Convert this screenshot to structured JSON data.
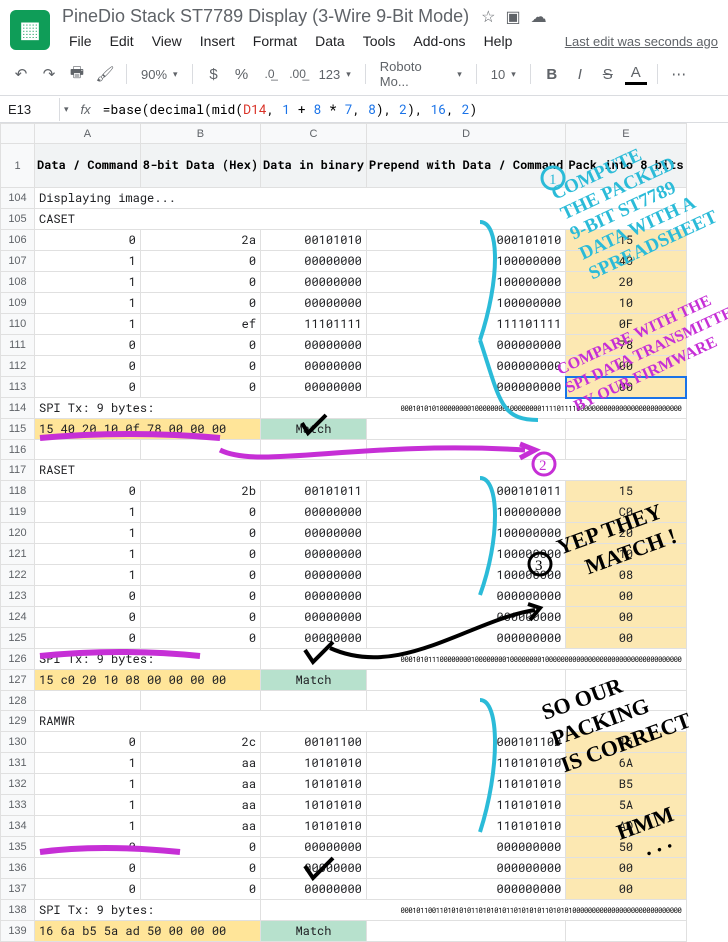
{
  "doc_title": "PineDio Stack ST7789 Display (3-Wire 9-Bit Mode)",
  "menu": [
    "File",
    "Edit",
    "View",
    "Insert",
    "Format",
    "Data",
    "Tools",
    "Add-ons",
    "Help"
  ],
  "last_edit": "Last edit was seconds ago",
  "toolbar": {
    "zoom": "90%",
    "number_fmt": "123",
    "font": "Roboto Mo...",
    "font_size": "10"
  },
  "name_box": "E13",
  "formula_tokens": [
    {
      "t": "=",
      "c": "tok-black"
    },
    {
      "t": "base",
      "c": "tok-black"
    },
    {
      "t": "(",
      "c": "tok-black"
    },
    {
      "t": "decimal",
      "c": "tok-black"
    },
    {
      "t": "(",
      "c": "tok-black"
    },
    {
      "t": "mid",
      "c": "tok-black"
    },
    {
      "t": "(",
      "c": "tok-black"
    },
    {
      "t": "D14",
      "c": "tok-orange"
    },
    {
      "t": ", ",
      "c": "tok-black"
    },
    {
      "t": "1",
      "c": "tok-blue"
    },
    {
      "t": " + ",
      "c": "tok-black"
    },
    {
      "t": "8",
      "c": "tok-blue"
    },
    {
      "t": " * ",
      "c": "tok-black"
    },
    {
      "t": "7",
      "c": "tok-blue"
    },
    {
      "t": ", ",
      "c": "tok-black"
    },
    {
      "t": "8",
      "c": "tok-blue"
    },
    {
      "t": ")",
      "c": "tok-black"
    },
    {
      "t": ", ",
      "c": "tok-black"
    },
    {
      "t": "2",
      "c": "tok-blue"
    },
    {
      "t": ")",
      "c": "tok-black"
    },
    {
      "t": ", ",
      "c": "tok-black"
    },
    {
      "t": "16",
      "c": "tok-blue"
    },
    {
      "t": ", ",
      "c": "tok-black"
    },
    {
      "t": "2",
      "c": "tok-blue"
    },
    {
      "t": ")",
      "c": "tok-black"
    }
  ],
  "columns": [
    "A",
    "B",
    "C",
    "D",
    "E"
  ],
  "headers": {
    "A": "Data / Command",
    "B": "8-bit Data (Hex)",
    "C": "Data in binary",
    "D": "Prepend with Data / Command",
    "E": "Pack into 8 bits"
  },
  "rows": [
    {
      "n": 104,
      "type": "text",
      "a": "Displaying image..."
    },
    {
      "n": 105,
      "type": "text",
      "a": "CASET"
    },
    {
      "n": 106,
      "type": "data",
      "a": "0",
      "b": "2a",
      "c": "00101010",
      "d": "000101010",
      "e": "15"
    },
    {
      "n": 107,
      "type": "data",
      "a": "1",
      "b": "0",
      "c": "00000000",
      "d": "100000000",
      "e": "40"
    },
    {
      "n": 108,
      "type": "data",
      "a": "1",
      "b": "0",
      "c": "00000000",
      "d": "100000000",
      "e": "20"
    },
    {
      "n": 109,
      "type": "data",
      "a": "1",
      "b": "0",
      "c": "00000000",
      "d": "100000000",
      "e": "10"
    },
    {
      "n": 110,
      "type": "data",
      "a": "1",
      "b": "ef",
      "c": "11101111",
      "d": "111101111",
      "e": "0F"
    },
    {
      "n": 111,
      "type": "data",
      "a": "0",
      "b": "0",
      "c": "00000000",
      "d": "000000000",
      "e": "78"
    },
    {
      "n": 112,
      "type": "data",
      "a": "0",
      "b": "0",
      "c": "00000000",
      "d": "000000000",
      "e": "00"
    },
    {
      "n": 113,
      "type": "data",
      "a": "0",
      "b": "0",
      "c": "00000000",
      "d": "000000000",
      "e": "00"
    },
    {
      "n": 114,
      "type": "spi",
      "a": "SPI Tx: 9 bytes:",
      "bin": "000101010100000000100000000100000000111101111000000000000000000000000000"
    },
    {
      "n": 115,
      "type": "hex",
      "hex": [
        "15",
        "40",
        "20",
        "10",
        "0f",
        "78",
        "00",
        "00",
        "00"
      ],
      "status": "Match"
    },
    {
      "n": 116,
      "type": "blank"
    },
    {
      "n": 117,
      "type": "text",
      "a": "RASET"
    },
    {
      "n": 118,
      "type": "data",
      "a": "0",
      "b": "2b",
      "c": "00101011",
      "d": "000101011",
      "e": "15"
    },
    {
      "n": 119,
      "type": "data",
      "a": "1",
      "b": "0",
      "c": "00000000",
      "d": "100000000",
      "e": "C0"
    },
    {
      "n": 120,
      "type": "data",
      "a": "1",
      "b": "0",
      "c": "00000000",
      "d": "100000000",
      "e": "20"
    },
    {
      "n": 121,
      "type": "data",
      "a": "1",
      "b": "0",
      "c": "00000000",
      "d": "100000000",
      "e": "10"
    },
    {
      "n": 122,
      "type": "data",
      "a": "1",
      "b": "0",
      "c": "00000000",
      "d": "100000000",
      "e": "08"
    },
    {
      "n": 123,
      "type": "data",
      "a": "0",
      "b": "0",
      "c": "00000000",
      "d": "000000000",
      "e": "00"
    },
    {
      "n": 124,
      "type": "data",
      "a": "0",
      "b": "0",
      "c": "00000000",
      "d": "000000000",
      "e": "00"
    },
    {
      "n": 125,
      "type": "data",
      "a": "0",
      "b": "0",
      "c": "00000000",
      "d": "000000000",
      "e": "00"
    },
    {
      "n": 126,
      "type": "spi",
      "a": "SPI Tx: 9 bytes:",
      "bin": "000101011100000000100000000100000000100000000000000000000000000000000000"
    },
    {
      "n": 127,
      "type": "hex",
      "hex": [
        "15",
        "c0",
        "20",
        "10",
        "08",
        "00",
        "00",
        "00",
        "00"
      ],
      "status": "Match"
    },
    {
      "n": 128,
      "type": "blank"
    },
    {
      "n": 129,
      "type": "text",
      "a": "RAMWR"
    },
    {
      "n": 130,
      "type": "data",
      "a": "0",
      "b": "2c",
      "c": "00101100",
      "d": "000101100",
      "e": "16"
    },
    {
      "n": 131,
      "type": "data",
      "a": "1",
      "b": "aa",
      "c": "10101010",
      "d": "110101010",
      "e": "6A"
    },
    {
      "n": 132,
      "type": "data",
      "a": "1",
      "b": "aa",
      "c": "10101010",
      "d": "110101010",
      "e": "B5"
    },
    {
      "n": 133,
      "type": "data",
      "a": "1",
      "b": "aa",
      "c": "10101010",
      "d": "110101010",
      "e": "5A"
    },
    {
      "n": 134,
      "type": "data",
      "a": "1",
      "b": "aa",
      "c": "10101010",
      "d": "110101010",
      "e": "AD"
    },
    {
      "n": 135,
      "type": "data",
      "a": "0",
      "b": "0",
      "c": "00000000",
      "d": "000000000",
      "e": "50"
    },
    {
      "n": 136,
      "type": "data",
      "a": "0",
      "b": "0",
      "c": "00000000",
      "d": "000000000",
      "e": "00"
    },
    {
      "n": 137,
      "type": "data",
      "a": "0",
      "b": "0",
      "c": "00000000",
      "d": "000000000",
      "e": "00"
    },
    {
      "n": 138,
      "type": "spi",
      "a": "SPI Tx: 9 bytes:",
      "bin": "000101100110101010110101010110101010110101010000000000000000000000000000"
    },
    {
      "n": 139,
      "type": "hex",
      "hex": [
        "16",
        "6a",
        "b5",
        "5a",
        "ad",
        "50",
        "00",
        "00",
        "00"
      ],
      "status": "Match"
    }
  ],
  "annotations": {
    "note1": "① COMPUTE THE PACKED 9-BIT ST7789 DATA WITH A SPREADSHEET",
    "note2": "② COMPARE WITH THE SPI DATA TRANSMITTED BY OUR FIRMWARE",
    "note3": "③ YEP THEY MATCH !",
    "note4": "SO OUR PACKING IS CORRECT",
    "note5": "HMM ...",
    "color1": "#2bbbd8",
    "color2": "#c62fd6",
    "color3": "#000000"
  }
}
